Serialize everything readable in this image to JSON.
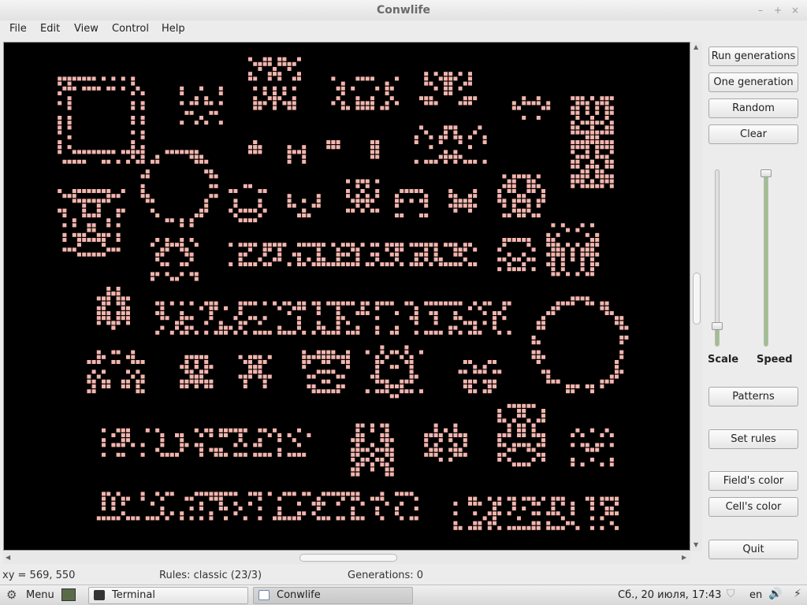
{
  "window": {
    "title": "Conwlife",
    "minimize": "–",
    "maximize": "+",
    "close": "×"
  },
  "menu": {
    "file": "File",
    "edit": "Edit",
    "view": "View",
    "control": "Control",
    "help": "Help"
  },
  "colors": {
    "field": "#000000",
    "cell": "#f2b5ad",
    "scale_track": "#9fc08d",
    "speed_track": "#9fc08d"
  },
  "buttons": {
    "run": "Run generations",
    "one": "One generation",
    "random": "Random",
    "clear": "Clear",
    "patterns": "Patterns",
    "set_rules": "Set rules",
    "field_color": "Field's color",
    "cell_color": "Cell's color",
    "quit": "Quit"
  },
  "sliders": {
    "scale": {
      "label": "Scale",
      "value": 0.1
    },
    "speed": {
      "label": "Speed",
      "value": 1.0
    }
  },
  "status": {
    "xy": "xy = 569, 550",
    "rules": "Rules: classic (23/3)",
    "generations": "Generations:  0"
  },
  "taskbar": {
    "menu": "Menu",
    "task_terminal": "Terminal",
    "task_conwlife": "Conwlife",
    "datetime": "Сб., 20 июля, 17:43",
    "lang": "en"
  }
}
